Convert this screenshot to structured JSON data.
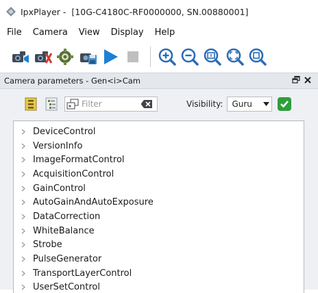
{
  "window": {
    "app_name": "IpxPlayer -",
    "camera_info": "[10G-C4180C-RF0000000, SN.00880001]"
  },
  "menu": [
    "File",
    "Camera",
    "View",
    "Display",
    "Help"
  ],
  "toolbar": {
    "buttons": [
      "camera-connect-icon",
      "camera-disconnect-icon",
      "camera-settings-icon",
      "save-settings-icon",
      "play-icon",
      "stop-icon"
    ],
    "zoom_buttons": [
      "zoom-in-icon",
      "zoom-out-icon",
      "zoom-actual-icon",
      "zoom-fit-icon",
      "zoom-extra-icon"
    ]
  },
  "dock": {
    "title": "Camera parameters - Gen<i>Cam",
    "float_label": "Ȣ",
    "close_label": "×"
  },
  "controls": {
    "filter_placeholder": "Filter",
    "visibility_label": "Visibility:",
    "visibility_value": "Guru"
  },
  "tree": {
    "items": [
      "DeviceControl",
      "VersionInfo",
      "ImageFormatControl",
      "AcquisitionControl",
      "GainControl",
      "AutoGainAndAutoExposure",
      "DataCorrection",
      "WhiteBalance",
      "Strobe",
      "PulseGenerator",
      "TransportLayerControl",
      "UserSetControl"
    ]
  },
  "colors": {
    "accent_blue": "#1e7fd6",
    "zoom_blue": "#2a6cb6",
    "ok_green": "#2e9e3c",
    "stop_gray": "#bfbfbf"
  }
}
